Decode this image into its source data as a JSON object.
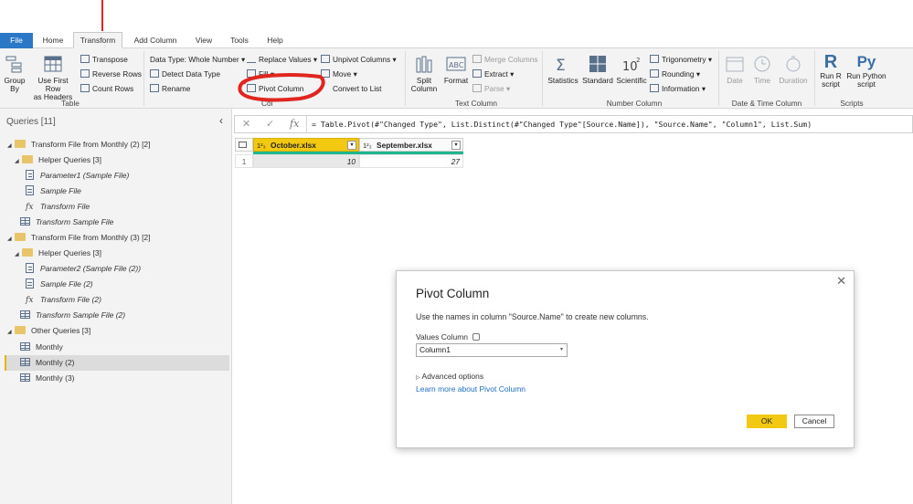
{
  "tabs": [
    "File",
    "Home",
    "Transform",
    "Add Column",
    "View",
    "Tools",
    "Help"
  ],
  "ribbon": {
    "table": {
      "group_by": "Group\nBy",
      "use_first_row": "Use First Row\nas Headers",
      "transpose": "Transpose",
      "reverse_rows": "Reverse Rows",
      "count_rows": "Count Rows",
      "label": "Table"
    },
    "any_column": {
      "data_type": "Data Type: Whole Number",
      "detect_data_type": "Detect Data Type",
      "rename": "Rename",
      "replace_values": "Replace Values",
      "fill": "Fill",
      "pivot_column": "Pivot Column",
      "unpivot_columns": "Unpivot Columns",
      "move": "Move",
      "convert_to_list": "Convert to List",
      "label_partial": "Col"
    },
    "text_column": {
      "split_column": "Split\nColumn",
      "format": "Format",
      "merge_columns": "Merge Columns",
      "extract": "Extract",
      "parse": "Parse",
      "label": "Text Column"
    },
    "number_column": {
      "statistics": "Statistics",
      "standard": "Standard",
      "scientific": "Scientific",
      "trigonometry": "Trigonometry",
      "rounding": "Rounding",
      "information": "Information",
      "label": "Number Column"
    },
    "datetime_column": {
      "date": "Date",
      "time": "Time",
      "duration": "Duration",
      "label": "Date & Time Column"
    },
    "scripts": {
      "run_r": "Run R\nscript",
      "run_python": "Run Python\nscript",
      "label": "Scripts"
    }
  },
  "queries": {
    "header": "Queries [11]",
    "items": [
      {
        "label": "Transform File from Monthly (2) [2]",
        "type": "folder"
      },
      {
        "label": "Helper Queries [3]",
        "type": "folder"
      },
      {
        "label": "Parameter1 (Sample File)",
        "type": "param"
      },
      {
        "label": "Sample File",
        "type": "doc"
      },
      {
        "label": "Transform File",
        "type": "fx"
      },
      {
        "label": "Transform Sample File",
        "type": "table"
      },
      {
        "label": "Transform File from Monthly (3) [2]",
        "type": "folder"
      },
      {
        "label": "Helper Queries [3]",
        "type": "folder"
      },
      {
        "label": "Parameter2 (Sample File (2))",
        "type": "param"
      },
      {
        "label": "Sample File (2)",
        "type": "doc"
      },
      {
        "label": "Transform File (2)",
        "type": "fx"
      },
      {
        "label": "Transform Sample File (2)",
        "type": "table"
      },
      {
        "label": "Other Queries [3]",
        "type": "folder"
      },
      {
        "label": "Monthly",
        "type": "table"
      },
      {
        "label": "Monthly (2)",
        "type": "table",
        "selected": true
      },
      {
        "label": "Monthly (3)",
        "type": "table"
      }
    ]
  },
  "formula_bar": {
    "fx": "fx",
    "formula": "= Table.Pivot(#\"Changed Type\", List.Distinct(#\"Changed Type\"[Source.Name]), \"Source.Name\", \"Column1\", List.Sum)"
  },
  "grid": {
    "type_prefix": "1²₃",
    "columns": [
      "October.xlsx",
      "September.xlsx"
    ],
    "rows": [
      {
        "num": "1",
        "values": [
          "10",
          "27"
        ]
      }
    ]
  },
  "dialog": {
    "title": "Pivot Column",
    "description": "Use the names in column \"Source.Name\" to create new columns.",
    "values_column_label": "Values Column",
    "values_column_value": "Column1",
    "advanced_options": "Advanced options",
    "learn_more": "Learn more about Pivot Column",
    "ok": "OK",
    "cancel": "Cancel"
  },
  "colors": {
    "accent_yellow": "#f2c811",
    "file_tab_blue": "#2b79c6",
    "annotation_red": "#e0261f",
    "link_blue": "#1f6fc0"
  }
}
